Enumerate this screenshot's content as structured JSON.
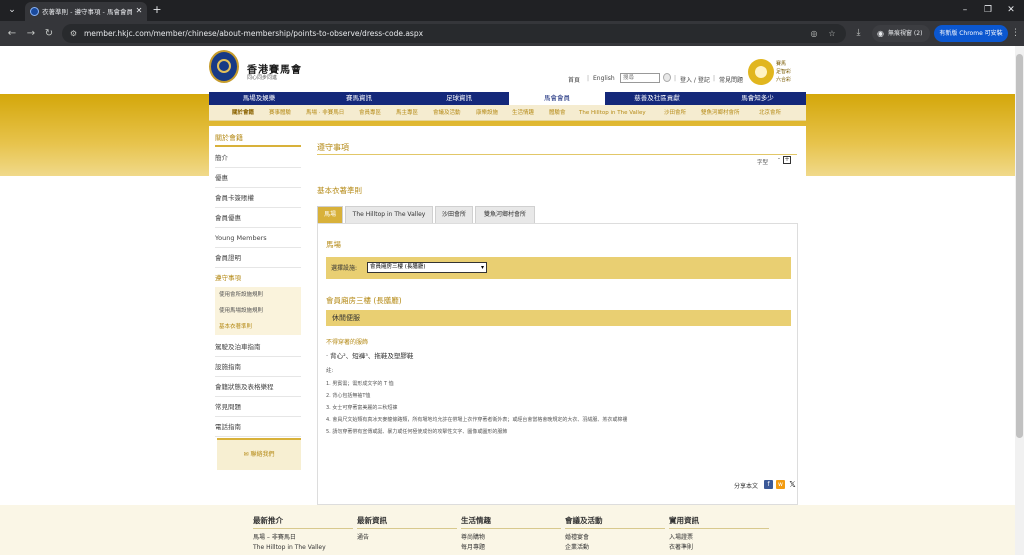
{
  "browser": {
    "tab_title": "衣著準則 - 遵守事項 - 馬會會員",
    "url": "member.hkjc.com/member/chinese/about-membership/points-to-observe/dress-code.aspx",
    "guest_label": "無痕視窗 (2)",
    "update_label": "有新版 Chrome 可安裝"
  },
  "header": {
    "logo_name": "香港賽馬會",
    "logo_slogan": "同心同步同進",
    "util_links": [
      "首頁",
      "English",
      "登入 / 登記",
      "常見問題"
    ],
    "search_placeholder": "搜尋",
    "badge_lines": [
      "賽馬",
      "足智彩",
      "六合彩"
    ]
  },
  "main_nav": {
    "items": [
      "馬場及娛樂",
      "賽馬資訊",
      "足球資訊",
      "馬會會員",
      "慈善及社區貢獻",
      "馬會知多少"
    ],
    "active_index": 3
  },
  "sub_nav": {
    "items": [
      "關於會籍",
      "賽事體驗",
      "馬場 · 非賽馬日",
      "會員專區",
      "馬主專區",
      "會議及活動",
      "康樂設施",
      "生活情趣",
      "體驗會",
      "The Hilltop in The Valley",
      "沙田會所",
      "雙魚河鄉村會所",
      "北京會所"
    ],
    "active_index": 0
  },
  "sidebar": {
    "heading": "關於會籍",
    "items": [
      "簡介",
      "優惠",
      "會員卡簽賬權",
      "會員優惠",
      "Young Members",
      "會員證明",
      "遵守事項"
    ],
    "sub_items": [
      "使用會所設施規則",
      "使用馬場設施規則",
      "基本衣著準則"
    ],
    "items_after": [
      "駕駛及泊車指南",
      "設施指南",
      "會籍狀態及表格樂程",
      "常見問題",
      "電話指南"
    ],
    "contact": "聯絡我們"
  },
  "main": {
    "title": "遵守事項",
    "font_size_label": "字型",
    "font_buttons": [
      "-",
      "+"
    ],
    "section_title": "基本衣著準則",
    "tabs": [
      "馬場",
      "The Hilltop in The Valley",
      "沙田會所",
      "雙魚河鄉村會所"
    ],
    "active_tab": 0,
    "venue_heading": "馬場",
    "select_label": "選擇設施:",
    "select_value": "會員廂房三樓 (長膳廳)",
    "venue_sub_heading": "會員廂房三樓 (長膳廳)",
    "dress_category": "休閒便服",
    "not_allowed_title": "不得穿著的服飾",
    "not_allowed_items": "· 背心²、短褲³、拖鞋及塑膠鞋",
    "notes_label": "註:",
    "notes": [
      "1. 男賓需；需形成文字的 T 恤",
      "2. 背心包括無袖T恤",
      "3. 女士可穿著富美麗的三秋短褲",
      "4. 會員尺文始類有真冰天麥龍條路類，所有場地均允許在帶場上衣作穿著者衛外表；或經台會當格會晚規定的大衣、羽絨服、羔衣或棉褸",
      "5. 請勿穿著帶有宣傳或誕、暴力或任何極使成份的攻擊性文字、圖像或圖形的服飾"
    ]
  },
  "share": {
    "label": "分享本文"
  },
  "footer": {
    "columns": [
      {
        "heading": "最新推介",
        "links": [
          "馬場 – 非賽馬日",
          "The Hilltop in The Valley"
        ]
      },
      {
        "heading": "最新資訊",
        "links": [
          "通告"
        ]
      },
      {
        "heading": "生活情趣",
        "links": [
          "尊尚購物",
          "每月專題"
        ]
      },
      {
        "heading": "會議及活動",
        "links": [
          "婚禮宴會",
          "企業活動"
        ]
      },
      {
        "heading": "實用資訊",
        "links": [
          "入場證票",
          "衣著準則"
        ]
      }
    ]
  },
  "colors": {
    "gold": "#d4a70a",
    "navy": "#14287a",
    "accent_text": "#b58a16"
  }
}
